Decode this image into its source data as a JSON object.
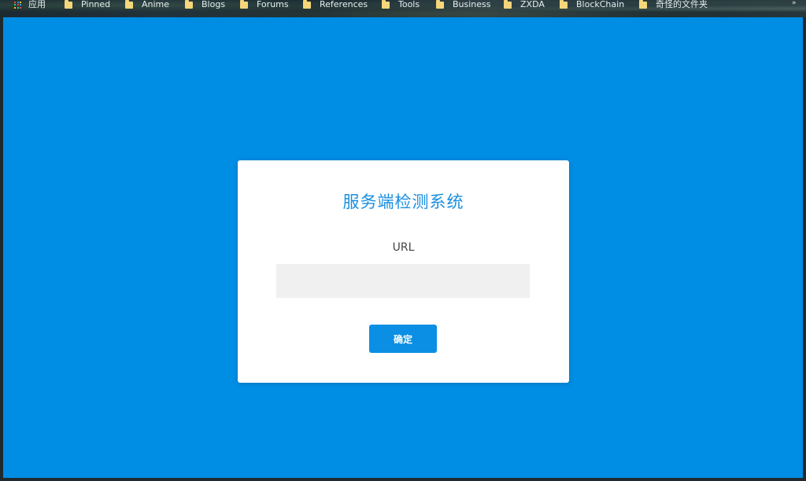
{
  "bookmarks": {
    "apps_label": "应用",
    "items": [
      {
        "label": "Pinned"
      },
      {
        "label": "Anime"
      },
      {
        "label": "Blogs"
      },
      {
        "label": "Forums"
      },
      {
        "label": "References"
      },
      {
        "label": "Tools"
      },
      {
        "label": "Business"
      },
      {
        "label": "ZXDA"
      },
      {
        "label": "BlockChain"
      },
      {
        "label": "奇怪的文件夹"
      }
    ]
  },
  "colors": {
    "page_background": "#008de4",
    "title": "#1a8fe0",
    "button": "#0a8fe4",
    "input_background": "#f0f0f0",
    "folder": "#f5d67a"
  },
  "card": {
    "title": "服务端检测系统",
    "url_label": "URL",
    "url_value": "",
    "url_placeholder": "",
    "confirm_label": "确定"
  }
}
